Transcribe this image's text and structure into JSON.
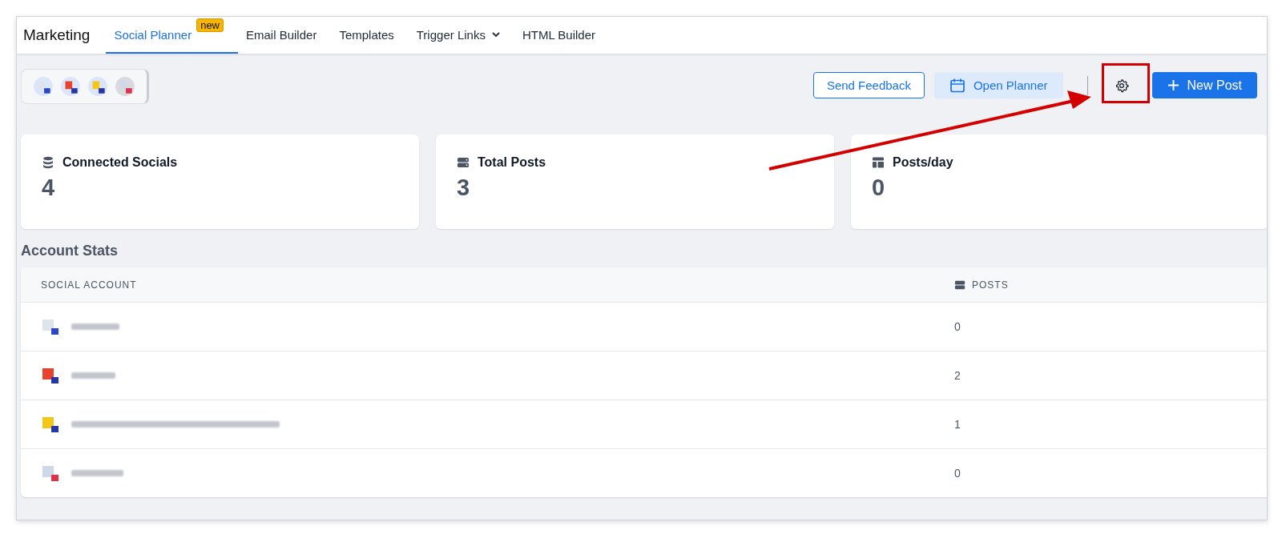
{
  "nav": {
    "title": "Marketing",
    "tabs": [
      {
        "label": "Social Planner",
        "selected": true,
        "badge": "new"
      },
      {
        "label": "Email Builder",
        "selected": false
      },
      {
        "label": "Templates",
        "selected": false
      },
      {
        "label": "Trigger Links",
        "selected": false,
        "dropdown": true
      },
      {
        "label": "HTML Builder",
        "selected": false
      }
    ]
  },
  "toolbar": {
    "feedback_button": "Send Feedback",
    "planner_button": "Open Planner",
    "new_post_button": "New Post"
  },
  "stats": [
    {
      "kind": "database",
      "label": "Connected Socials",
      "value": "4"
    },
    {
      "kind": "server",
      "label": "Total Posts",
      "value": "3"
    },
    {
      "kind": "layout",
      "label": "Posts/day",
      "value": "0"
    }
  ],
  "account_stats": {
    "title": "Account Stats",
    "columns": [
      "SOCIAL ACCOUNT",
      "POSTS"
    ],
    "rows": [
      {
        "posts": "0"
      },
      {
        "posts": "2"
      },
      {
        "posts": "1"
      },
      {
        "posts": "0"
      }
    ]
  }
}
